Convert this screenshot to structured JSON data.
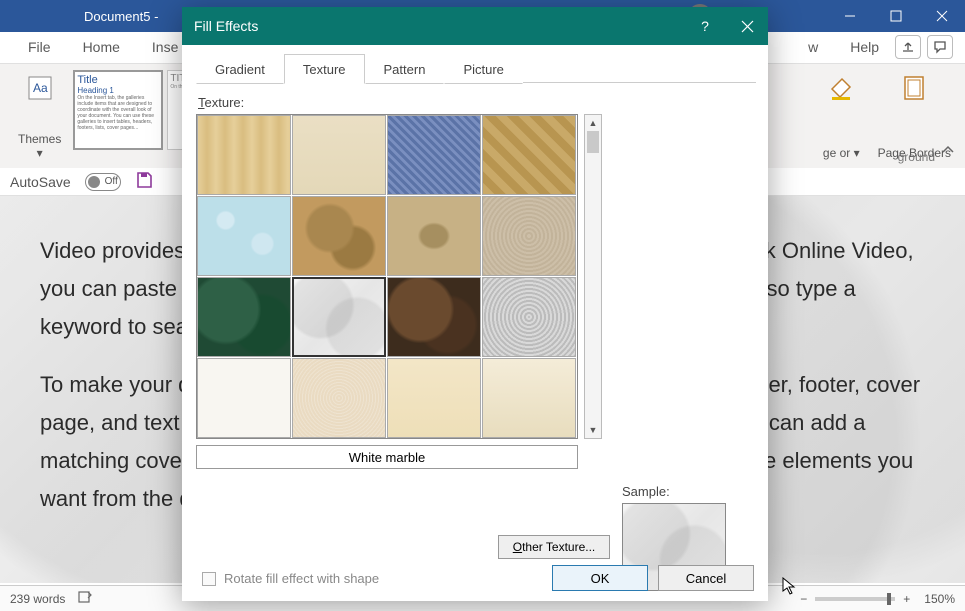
{
  "window": {
    "title": "Document5  -"
  },
  "menubar": {
    "tabs": [
      "File",
      "Home",
      "Inse",
      "w",
      "Help"
    ]
  },
  "ribbon": {
    "themes_label": "Themes",
    "gallery": {
      "title": "Title",
      "heading": "Heading 1",
      "body": "On the Insert tab, the galleries include items that are designed to coordinate with the overall look of your document. You can use these galleries to insert tables, headers, footers, lists, cover pages...",
      "item2": "TIT",
      "item2body": "On the In"
    },
    "pagecolor": "ge or ▾",
    "pageborders": "Page Borders",
    "groupname": "ground"
  },
  "autosave": {
    "label": "AutoSave",
    "state": "Off"
  },
  "document": {
    "p1": "Video provides a powerful way to help you prove your point. When you click Online Video, you can paste in the embed code for the video you want to add. You can also type a keyword to search online for the video that best fits your document.",
    "p2": "To make your document look professionally produced, Word provides header, footer, cover page, and text box designs that complement each other. For example, you can add a matching cover page, header, and sidebar. Click Insert and then choose the elements you want from the different."
  },
  "statusbar": {
    "words": "239 words",
    "zoom": "150%"
  },
  "dialog": {
    "title": "Fill Effects",
    "tabs": {
      "gradient": "Gradient",
      "texture": "Texture",
      "pattern": "Pattern",
      "picture": "Picture"
    },
    "texture_label_pre": "T",
    "texture_label": "exture:",
    "textures": [
      "Papyrus",
      "Canvas",
      "Denim",
      "Woven mat",
      "Water droplets",
      "Paper bag",
      "Fish fossil",
      "Sand",
      "Green marble",
      "White marble",
      "Brown marble",
      "Granite",
      "Newsprint",
      "Recycled paper",
      "Parchment",
      "Stationery"
    ],
    "selected_name": "White marble",
    "other_btn_pre": "O",
    "other_btn": "ther Texture...",
    "sample_label": "Sample:",
    "rotate_label": "Rotate fill effect with shape",
    "ok": "OK",
    "cancel": "Cancel"
  }
}
